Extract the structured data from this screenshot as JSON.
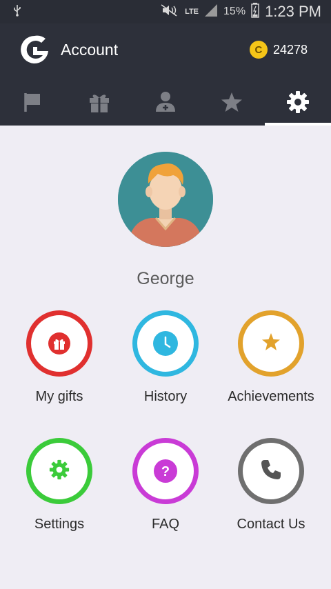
{
  "status_bar": {
    "network": "LTE",
    "battery": "15%",
    "time": "1:23 PM"
  },
  "header": {
    "title": "Account",
    "coins": "24278",
    "coin_symbol": "C"
  },
  "tabs": [
    {
      "icon": "flag-icon"
    },
    {
      "icon": "gift-icon"
    },
    {
      "icon": "add-friend-icon"
    },
    {
      "icon": "star-icon"
    },
    {
      "icon": "gear-icon",
      "active": true
    }
  ],
  "profile": {
    "name": "George"
  },
  "menu": [
    {
      "label": "My gifts",
      "icon": "gift-icon",
      "color": "#e0302f"
    },
    {
      "label": "History",
      "icon": "clock-icon",
      "color": "#2fb7e0"
    },
    {
      "label": "Achievements",
      "icon": "star-icon",
      "color": "#e2a22c"
    },
    {
      "label": "Settings",
      "icon": "gear-icon",
      "color": "#3bcb3a"
    },
    {
      "label": "FAQ",
      "icon": "question-icon",
      "color": "#c93bd6"
    },
    {
      "label": "Contact Us",
      "icon": "phone-icon",
      "color": "#6f6f6f"
    }
  ]
}
